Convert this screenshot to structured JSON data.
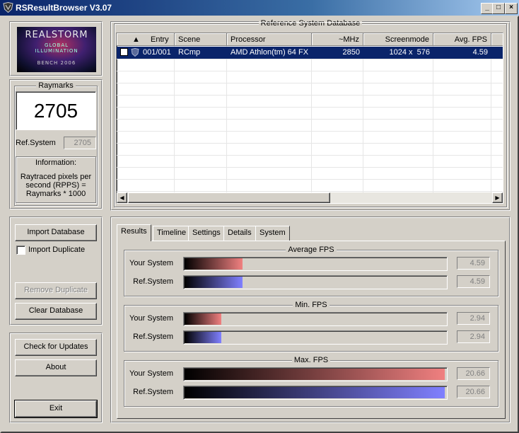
{
  "window": {
    "title": "RSResultBrowser V3.07",
    "min_label": "_",
    "max_label": "□",
    "close_label": "×"
  },
  "logo": {
    "line1": "REALSTORM",
    "line2": "GLOBAL",
    "line3": "ILLUMINATION",
    "line4": "BENCH 2006"
  },
  "raymarks": {
    "title": "Raymarks",
    "value": "2705",
    "ref_label": "Ref.System",
    "ref_value": "2705",
    "info_title": "Information:",
    "info_text": "Raytraced pixels per second (RPPS) = Raymarks * 1000"
  },
  "db_buttons": {
    "import_label": "Import Database",
    "import_duplicate_label": "Import Duplicate",
    "import_duplicate_checked": false,
    "remove_duplicate_label": "Remove Duplicate",
    "clear_label": "Clear Database"
  },
  "misc_buttons": {
    "updates_label": "Check for Updates",
    "about_label": "About",
    "exit_label": "Exit"
  },
  "reference_db": {
    "title": "Reference System Database",
    "sort_indicator": "▲",
    "columns": [
      "Entry",
      "Scene",
      "Processor",
      "~MHz",
      "Screenmode",
      "Avg. FPS"
    ],
    "rows": [
      {
        "entry": "001/001",
        "scene": "RCmp",
        "processor": "AMD Athlon(tm) 64 FX",
        "mhz": "2850",
        "screenmode": "1024 x  576",
        "avg_fps": "4.59",
        "selected": true
      }
    ]
  },
  "tabs": [
    "Results",
    "Timeline",
    "Settings",
    "Details",
    "System"
  ],
  "active_tab": "Results",
  "results": {
    "your_label": "Your System",
    "ref_label": "Ref.System",
    "groups": [
      {
        "title": "Average FPS",
        "your_value": "4.59",
        "ref_value": "4.59",
        "your_fraction": 0.222,
        "ref_fraction": 0.222
      },
      {
        "title": "Min. FPS",
        "your_value": "2.94",
        "ref_value": "2.94",
        "your_fraction": 0.142,
        "ref_fraction": 0.142
      },
      {
        "title": "Max. FPS",
        "your_value": "20.66",
        "ref_value": "20.66",
        "your_fraction": 1.0,
        "ref_fraction": 1.0
      }
    ]
  },
  "colors": {
    "selection": "#0a246a",
    "your_bar": "#f08080",
    "ref_bar": "#8080ff"
  }
}
